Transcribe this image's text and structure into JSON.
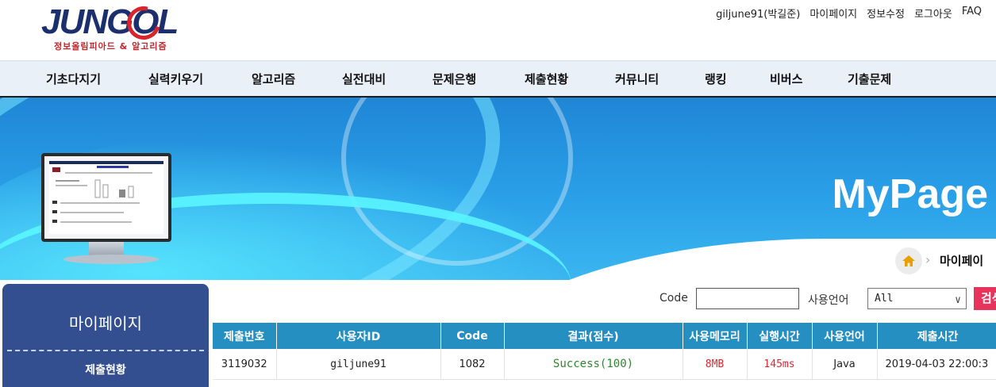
{
  "header": {
    "logo_text": "JUNGOL",
    "logo_subtitle": "정보올림피아드 & 알고리즘",
    "util_nav": [
      "giljune91(박길준)",
      "마이페이지",
      "정보수정",
      "로그아웃",
      "FAQ"
    ]
  },
  "menu": [
    "기초다지기",
    "실력키우기",
    "알고리즘",
    "실전대비",
    "문제은행",
    "제출현황",
    "커뮤니티",
    "랭킹",
    "비버스",
    "기출문제"
  ],
  "banner": {
    "title": "MyPage"
  },
  "breadcrumb": {
    "current": "마이페이"
  },
  "search": {
    "code_label": "Code",
    "code_value": "",
    "language_label": "사용언어",
    "language_selected": "All",
    "search_button": "검색"
  },
  "sidebar": {
    "title": "마이페이지",
    "items": [
      "제출현황"
    ]
  },
  "table": {
    "headers": [
      "제출번호",
      "사용자ID",
      "Code",
      "결과(점수)",
      "사용메모리",
      "실행시간",
      "사용언어",
      "제출시간"
    ],
    "rows": [
      {
        "id": "3119032",
        "user": "giljune91",
        "code": "1082",
        "result": "Success(100)",
        "memory": "8MB",
        "time": "145ms",
        "language": "Java",
        "submitted": "2019-04-03 22:00:3"
      }
    ]
  },
  "colors": {
    "header_blue": "#258fc2",
    "sidebar_blue": "#344f8f",
    "success_green": "#2a8a2a",
    "metric_red": "#e0262f",
    "search_pink": "#e8335d"
  }
}
